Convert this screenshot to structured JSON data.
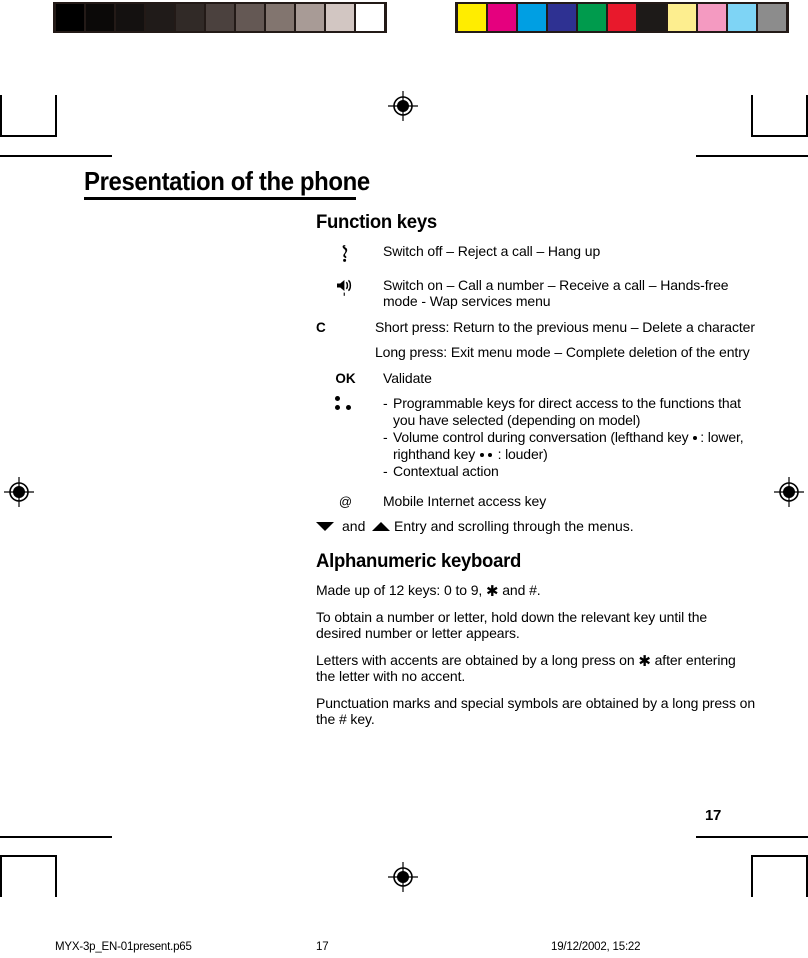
{
  "document": {
    "chapter_title": "Presentation of the phone",
    "page_number": "17"
  },
  "calibration": {
    "grey_bar_label": "greyscale-calibration-bar",
    "grey_swatches": [
      "#000000",
      "#0b0908",
      "#141110",
      "#201b19",
      "#312a27",
      "#4b413e",
      "#645854",
      "#82756f",
      "#a89b96",
      "#d2c6c2",
      "#ffffff"
    ],
    "color_bar_label": "color-calibration-bar",
    "color_swatches": [
      "#ffed00",
      "#e5007e",
      "#009fe3",
      "#2e3192",
      "#009b4d",
      "#e8192c",
      "#1d1a18",
      "#fdee8f",
      "#f49ac1",
      "#7ed4f5",
      "#8c8c8c"
    ]
  },
  "sections": [
    {
      "heading": "Function keys",
      "rows": [
        {
          "key_type": "icon",
          "key_icon": "hangup-phone-icon",
          "key_label": "",
          "description": "Switch off – Reject a call – Hang up"
        },
        {
          "key_type": "icon",
          "key_icon": "speaker-icon",
          "key_label": "",
          "description": "Switch on – Call a number – Receive a call – Hands-free mode - Wap services menu"
        },
        {
          "key_type": "text",
          "key_icon": "c-key",
          "key_label": "C",
          "description": "Short press: Return to the previous menu – Delete a character"
        },
        {
          "key_type": "continuation",
          "key_icon": "",
          "key_label": "",
          "description": "Long press: Exit menu mode – Complete deletion of the entry"
        },
        {
          "key_type": "text",
          "key_icon": "ok-key",
          "key_label": "OK",
          "description": "Validate"
        }
      ],
      "programmable": {
        "key_icon": "three-dots-soft-keys-icon",
        "bullets": [
          {
            "dash": "-",
            "parts": [
              {
                "t": "text",
                "v": "Programmable keys for direct access to the functions that you have selected (depending on model)"
              }
            ]
          },
          {
            "dash": "-",
            "parts": [
              {
                "t": "text",
                "v": "Volume control during conversation (lefthand key "
              },
              {
                "t": "dot1",
                "v": ""
              },
              {
                "t": "text",
                "v": ": lower, righthand key "
              },
              {
                "t": "dot2",
                "v": ""
              },
              {
                "t": "text",
                "v": " : louder)"
              }
            ]
          },
          {
            "dash": "-",
            "parts": [
              {
                "t": "text",
                "v": "Contextual action"
              }
            ]
          }
        ]
      },
      "at_row": {
        "key_label": "@",
        "description": "Mobile Internet access key"
      },
      "arrow_row": {
        "down_icon": "arrow-down-icon",
        "and_label": "and",
        "up_icon": "arrow-up-icon",
        "description": "Entry and scrolling through the menus."
      }
    },
    {
      "heading": "Alphanumeric keyboard",
      "paragraphs": [
        {
          "parts": [
            {
              "t": "text",
              "v": "Made up of 12 keys: 0 to 9, "
            },
            {
              "t": "ast",
              "v": "✱"
            },
            {
              "t": "text",
              "v": " and #."
            }
          ]
        },
        {
          "parts": [
            {
              "t": "text",
              "v": "To obtain a number or letter, hold down the relevant key until the desired number or letter appears."
            }
          ]
        },
        {
          "parts": [
            {
              "t": "text",
              "v": "Letters with accents are obtained by a long press on "
            },
            {
              "t": "ast",
              "v": "✱"
            },
            {
              "t": "text",
              "v": " after entering the letter with no accent."
            }
          ]
        },
        {
          "parts": [
            {
              "t": "text",
              "v": "Punctuation marks and special symbols are obtained by a long press on the # key."
            }
          ]
        }
      ]
    }
  ],
  "footer": {
    "filename": "MYX-3p_EN-01present.p65",
    "page": "17",
    "timestamp": "19/12/2002, 15:22"
  }
}
